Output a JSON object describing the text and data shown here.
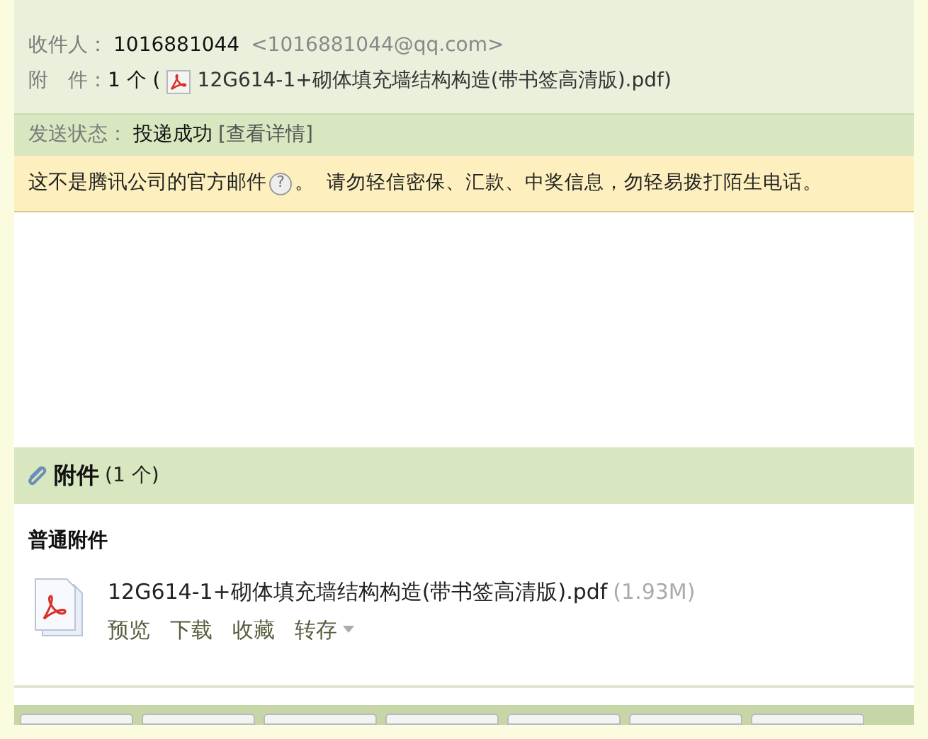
{
  "header": {
    "recipient_label": "收件人：",
    "recipient_name": "1016881044",
    "recipient_address": "<1016881044@qq.com>",
    "attachment_label": "附　件：",
    "attachment_count": "1 个 (",
    "attachment_name": "12G614-1+砌体填充墙结构构造(带书签高清版).pdf",
    "attachment_close": ")"
  },
  "status": {
    "label": "发送状态：",
    "value": "投递成功",
    "link": "[查看详情]"
  },
  "warning": {
    "text": "这不是腾讯公司的官方邮件",
    "help": "?",
    "advice": "。  请勿轻信密保、汇款、中奖信息，勿轻易拨打陌生电话。"
  },
  "attachments": {
    "title": "附件",
    "count": "(1 个)",
    "group": "普通附件",
    "files": [
      {
        "name": "12G614-1+砌体填充墙结构构造(带书签高清版).pdf",
        "size": "(1.93M)",
        "actions": [
          {
            "label": "预览",
            "kind": "link"
          },
          {
            "label": "下载",
            "kind": "link"
          },
          {
            "label": "收藏",
            "kind": "link"
          },
          {
            "label": "转存",
            "kind": "menu"
          }
        ]
      }
    ]
  }
}
